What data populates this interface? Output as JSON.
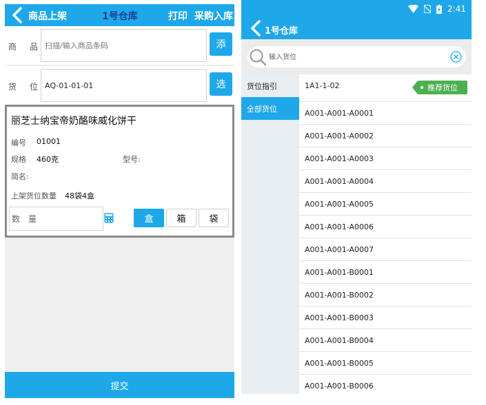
{
  "colors": {
    "primary": "#1ea8ea",
    "recommend": "#4caf50",
    "warehouse_title": "#1a3f99"
  },
  "left": {
    "header": {
      "title": "商品上架",
      "warehouse": "1号仓库",
      "print": "打印",
      "purchase_in": "采购入库"
    },
    "product_field": {
      "label_a": "商",
      "label_b": "品",
      "placeholder": "扫描/输入商品条码",
      "button": "添"
    },
    "location_field": {
      "label_a": "货",
      "label_b": "位",
      "value": "AQ-01-01-01",
      "button": "选"
    },
    "product": {
      "name": "丽芝士纳宝帝奶酪味威化饼干",
      "code_label": "编号",
      "code": "01001",
      "spec_label": "规格",
      "spec": "460克",
      "model_label": "型号:",
      "short_label": "简名:",
      "qty_label": "上架货位数量",
      "qty": "48袋4盒"
    },
    "quantity": {
      "placeholder": "数量"
    },
    "units": [
      "盒",
      "箱",
      "袋"
    ],
    "selected_unit": "盒",
    "submit": "提交"
  },
  "right": {
    "status": {
      "time": "2:41"
    },
    "header": {
      "title": "1号仓库"
    },
    "search": {
      "placeholder": "输入货位"
    },
    "categories": [
      "货位指引",
      "全部货位"
    ],
    "selected_category": "全部货位",
    "recommended_location": "1A1-1-02",
    "recommend_label": "推荐货位",
    "locations": [
      "A001-A001-A0001",
      "A001-A001-A0002",
      "A001-A001-A0003",
      "A001-A001-A0004",
      "A001-A001-A0005",
      "A001-A001-A0006",
      "A001-A001-A0007",
      "A001-A001-B0001",
      "A001-A001-B0002",
      "A001-A001-B0003",
      "A001-A001-B0004",
      "A001-A001-B0005",
      "A001-A001-B0006"
    ]
  }
}
